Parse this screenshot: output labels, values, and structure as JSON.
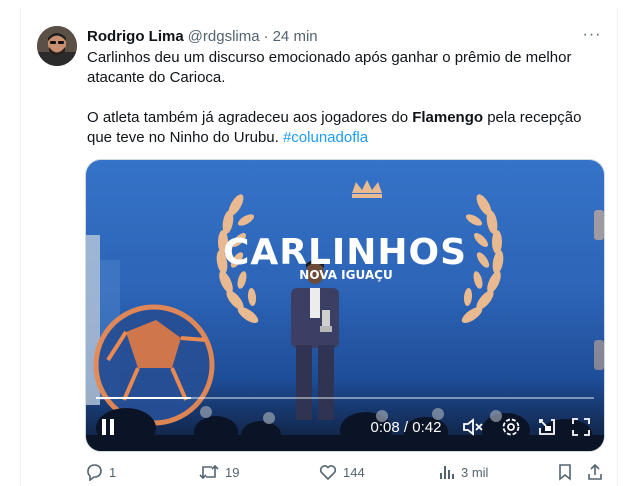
{
  "tweet": {
    "author_name": "Rodrigo Lima",
    "handle": "@rdgslima",
    "separator": "·",
    "time": "24 min",
    "more_label": "···",
    "line1": "Carlinhos deu um discurso emocionado após ganhar o prêmio de melhor atacante do Carioca.",
    "line2_start": "O atleta também já agradeceu aos jogadores do ",
    "line2_bold": "Flamengo",
    "line2_end": " pela recepção que teve no Ninho do Urubu. ",
    "hashtag": "#colunadofla"
  },
  "video": {
    "stage_title": "CARLINHOS",
    "stage_subtitle": "NOVA IGUAÇU",
    "timecode": "0:08 / 0:42",
    "progress": 0.19
  },
  "actions": {
    "replies": "1",
    "reposts": "19",
    "likes": "144",
    "views": "3 mil"
  },
  "colors": {
    "accent": "#1d9bf0",
    "muted": "#536471",
    "text": "#0f1419",
    "stage_blue": "#2d64b6",
    "laurel_gold": "#e9b98f"
  },
  "icons": [
    "more-icon",
    "play-pause-icon",
    "mute-icon",
    "settings-icon",
    "pip-icon",
    "fullscreen-icon",
    "reply-icon",
    "repost-icon",
    "like-icon",
    "views-icon",
    "bookmark-icon",
    "share-icon"
  ]
}
